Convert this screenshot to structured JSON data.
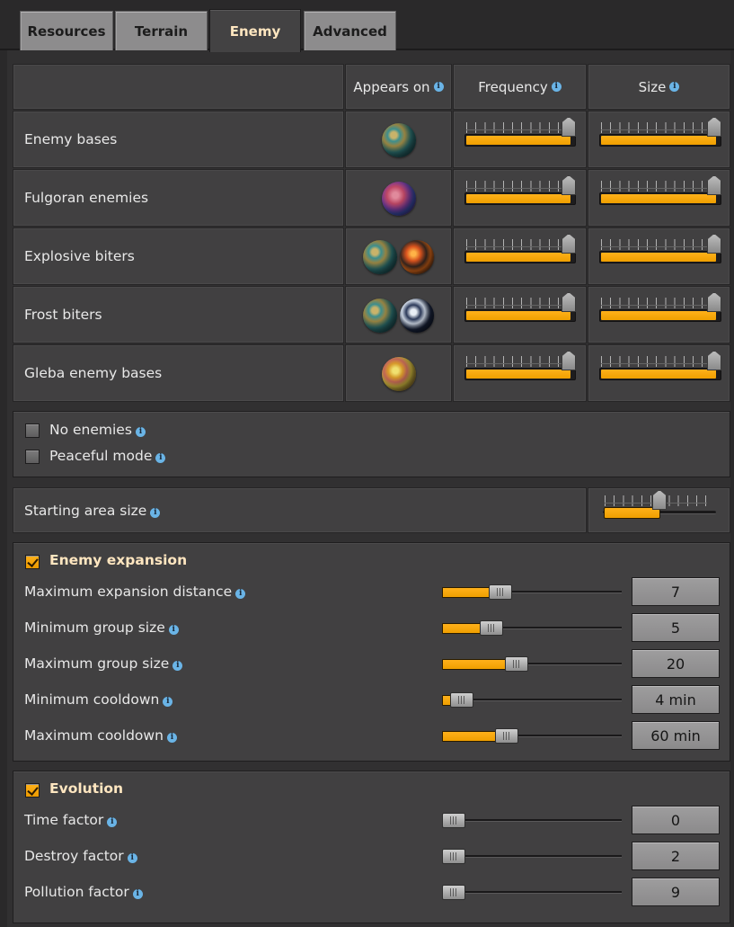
{
  "tabs": [
    {
      "label": "Resources",
      "active": false
    },
    {
      "label": "Terrain",
      "active": false
    },
    {
      "label": "Enemy",
      "active": true
    },
    {
      "label": "Advanced",
      "active": false
    }
  ],
  "table": {
    "headers": {
      "appears_on": "Appears on",
      "frequency": "Frequency",
      "size": "Size"
    },
    "rows": [
      {
        "label": "Enemy bases",
        "planets": [
          "nauvis"
        ],
        "frequency_fraction": 1.0,
        "size_fraction": 1.0
      },
      {
        "label": "Fulgoran enemies",
        "planets": [
          "fulgora"
        ],
        "frequency_fraction": 1.0,
        "size_fraction": 1.0
      },
      {
        "label": "Explosive biters",
        "planets": [
          "nauvis",
          "vulcanus"
        ],
        "frequency_fraction": 1.0,
        "size_fraction": 1.0
      },
      {
        "label": "Frost biters",
        "planets": [
          "nauvis",
          "aquilo"
        ],
        "frequency_fraction": 1.0,
        "size_fraction": 1.0
      },
      {
        "label": "Gleba enemy bases",
        "planets": [
          "gleba"
        ],
        "frequency_fraction": 1.0,
        "size_fraction": 1.0
      }
    ]
  },
  "options": {
    "no_enemies": {
      "label": "No enemies",
      "checked": false
    },
    "peaceful_mode": {
      "label": "Peaceful mode",
      "checked": false
    }
  },
  "starting_area": {
    "label": "Starting area size",
    "fraction": 0.5
  },
  "expansion": {
    "title": "Enemy expansion",
    "enabled": true,
    "settings": [
      {
        "label": "Maximum expansion distance",
        "value": "7",
        "fraction": 0.3
      },
      {
        "label": "Minimum group size",
        "value": "5",
        "fraction": 0.24
      },
      {
        "label": "Maximum group size",
        "value": "20",
        "fraction": 0.4
      },
      {
        "label": "Minimum cooldown",
        "value": "4 min",
        "fraction": 0.05
      },
      {
        "label": "Maximum cooldown",
        "value": "60 min",
        "fraction": 0.34
      }
    ]
  },
  "evolution": {
    "title": "Evolution",
    "enabled": true,
    "settings": [
      {
        "label": "Time factor",
        "value": "0",
        "fraction": 0.0
      },
      {
        "label": "Destroy factor",
        "value": "2",
        "fraction": 0.0
      },
      {
        "label": "Pollution factor",
        "value": "9",
        "fraction": 0.0
      }
    ]
  },
  "colors": {
    "accent": "#f5a50a",
    "title": "#ffe6c0",
    "info_icon": "#6ab4e6"
  }
}
